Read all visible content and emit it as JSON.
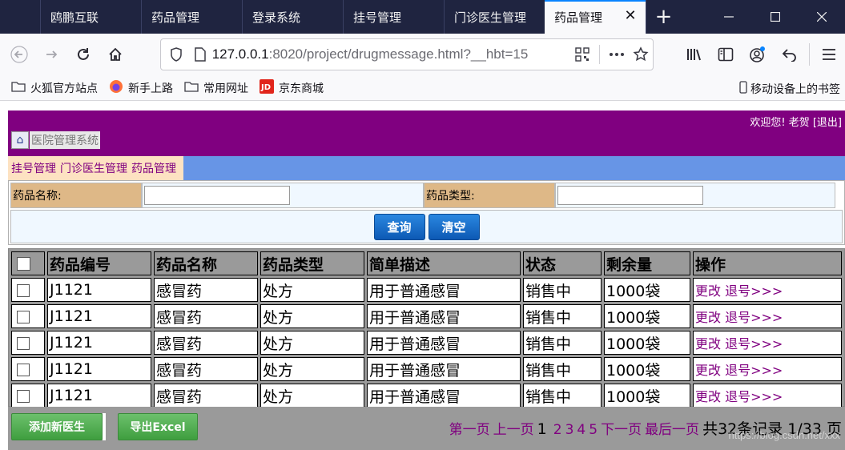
{
  "browser": {
    "tabs": [
      {
        "label": "鸥鹏互联"
      },
      {
        "label": "药品管理"
      },
      {
        "label": "登录系统"
      },
      {
        "label": "挂号管理"
      },
      {
        "label": "门诊医生管理"
      },
      {
        "label": "药品管理",
        "active": true
      }
    ],
    "new_tab_label": "+",
    "url_host": "127.0.0.1",
    "url_rest": ":8020/project/drugmessage.html?__hbt=15",
    "bookmarks": [
      "火狐官方站点",
      "新手上路",
      "常用网址",
      "京东商城"
    ],
    "mobile_bookmarks": "移动设备上的书签"
  },
  "header": {
    "welcome": "欢迎您!",
    "user": "老贺",
    "logout": "[退出]",
    "system_name": "医院管理系统"
  },
  "menu": {
    "items": [
      "挂号管理",
      "门诊医生管理",
      "药品管理"
    ]
  },
  "search": {
    "name_label": "药品名称:",
    "name_value": "",
    "type_label": "药品类型:",
    "type_value": "",
    "query_button": "查询",
    "clear_button": "清空"
  },
  "table": {
    "columns": [
      "药品编号",
      "药品名称",
      "药品类型",
      "简单描述",
      "状态",
      "剩余量",
      "操作"
    ],
    "rows": [
      {
        "id": "J1121",
        "name": "感冒药",
        "type": "处方",
        "desc": "用于普通感冒",
        "status": "销售中",
        "stock": "1000袋",
        "edit": "更改",
        "refund": "退号>>>"
      },
      {
        "id": "J1121",
        "name": "感冒药",
        "type": "处方",
        "desc": "用于普通感冒",
        "status": "销售中",
        "stock": "1000袋",
        "edit": "更改",
        "refund": "退号>>>"
      },
      {
        "id": "J1121",
        "name": "感冒药",
        "type": "处方",
        "desc": "用于普通感冒",
        "status": "销售中",
        "stock": "1000袋",
        "edit": "更改",
        "refund": "退号>>>"
      },
      {
        "id": "J1121",
        "name": "感冒药",
        "type": "处方",
        "desc": "用于普通感冒",
        "status": "销售中",
        "stock": "1000袋",
        "edit": "更改",
        "refund": "退号>>>"
      },
      {
        "id": "J1121",
        "name": "感冒药",
        "type": "处方",
        "desc": "用于普通感冒",
        "status": "销售中",
        "stock": "1000袋",
        "edit": "更改",
        "refund": "退号>>>"
      }
    ]
  },
  "footer": {
    "add_button": "添加新医生",
    "export_button": "导出Excel",
    "first_page": "第一页",
    "prev_page": "上一页",
    "current_page": "1",
    "pages": [
      "2",
      "3",
      "4",
      "5"
    ],
    "next_page": "下一页",
    "last_page": "最后一页",
    "summary": "共32条记录 1/33 页",
    "watermark": "https://blog.csdn.net/xxx"
  },
  "colors": {
    "header_bg": "#800080",
    "menu_bg": "#6795e6",
    "label_bg": "#deb887",
    "link": "#800080",
    "button_blue": "#1a6fce",
    "button_green": "#4fae4f"
  }
}
